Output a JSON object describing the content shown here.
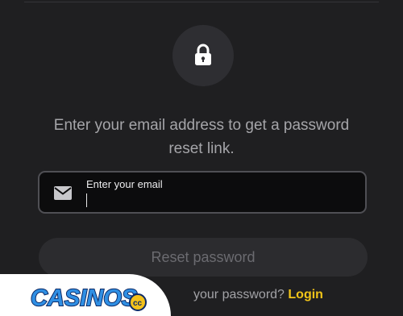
{
  "icons": {
    "lock": "lock-icon",
    "mail": "envelope-icon"
  },
  "instruction_text": "Enter your email address to get a password reset link.",
  "email_field": {
    "label": "Enter your email",
    "value": ""
  },
  "reset_button": {
    "label": "Reset password"
  },
  "footer": {
    "prompt": "your password?",
    "login_label": "Login"
  },
  "watermark": {
    "text": "CASINOS.cc"
  },
  "colors": {
    "background": "#1f1f21",
    "accent": "#f0c419",
    "input_background": "#0c0c0d",
    "button_disabled": "#2c2c2f"
  }
}
